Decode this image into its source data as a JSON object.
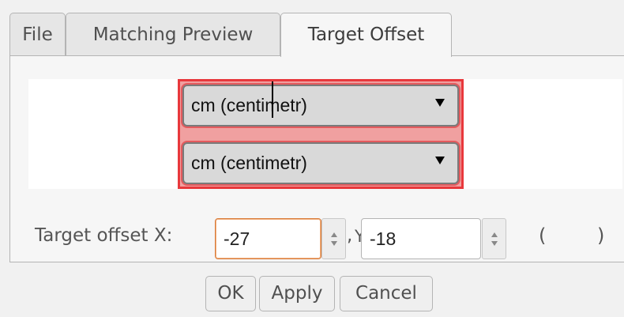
{
  "tabs": [
    {
      "label": "File"
    },
    {
      "label": "Matching Preview"
    },
    {
      "label": "Target Offset",
      "active": true
    }
  ],
  "unit_selects": [
    {
      "value": "cm (centimetr)"
    },
    {
      "value": "cm (centimetr)"
    }
  ],
  "offset": {
    "label": "Target offset",
    "x_label": "X:",
    "x_value": "-27",
    "separator": ",",
    "y_label": "Y:",
    "y_value": "-18",
    "paren_open": "(",
    "paren_close": ")"
  },
  "buttons": {
    "ok": "OK",
    "apply": "Apply",
    "cancel": "Cancel"
  },
  "colors": {
    "highlight_border": "#e8383c",
    "highlight_fill": "#f0a0a0",
    "focus_border": "#d97c3a"
  }
}
